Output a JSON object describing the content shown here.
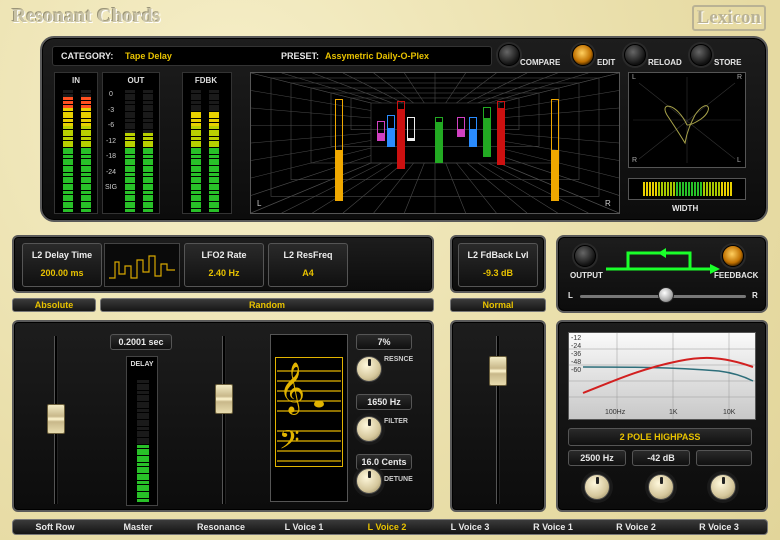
{
  "app": {
    "title": "Resonant Chords",
    "brand": "Lexicon"
  },
  "header": {
    "category_label": "CATEGORY:",
    "category_value": "Tape Delay",
    "preset_label": "PRESET:",
    "preset_value": "Assymetric Daily-O-Plex"
  },
  "buttons": {
    "compare": "COMPARE",
    "edit": "EDIT",
    "reload": "RELOAD",
    "store": "STORE"
  },
  "meters": {
    "in_label": "IN",
    "out_label": "OUT",
    "fdbk_label": "FDBK",
    "scale": [
      "0",
      "-3",
      "-6",
      "-12",
      "-18",
      "-24",
      "SIG"
    ],
    "in_level": 0.92,
    "out_level": 0.64,
    "fdbk_level": 0.82
  },
  "stage": {
    "left": "L",
    "right": "R"
  },
  "scope": {
    "l": "L",
    "r": "R",
    "width_label": "WIDTH"
  },
  "params": {
    "l2_delay_time": {
      "label": "L2 Delay Time",
      "value": "200.00 ms"
    },
    "lfo2_rate": {
      "label": "LFO2 Rate",
      "value": "2.40 Hz"
    },
    "l2_resfreq": {
      "label": "L2 ResFreq",
      "value": "A4"
    },
    "l2_fdback": {
      "label": "L2 FdBack Lvl",
      "value": "-9.3 dB"
    },
    "absolute": "Absolute",
    "random": "Random",
    "normal": "Normal"
  },
  "routing": {
    "output": "OUTPUT",
    "feedback": "FEEDBACK",
    "l": "L",
    "r": "R",
    "pan": 0.52
  },
  "delay": {
    "time": "0.2001 sec",
    "label": "DELAY",
    "level": 0.46
  },
  "voice": {
    "resonance_value": "7%",
    "resonance_label": "RESNCE",
    "filter_value": "1650 Hz",
    "filter_label": "FILTER",
    "detune_value": "16.0 Cents",
    "detune_label": "DETUNE"
  },
  "filter_eq": {
    "db_labels": [
      "-12",
      "-24",
      "-36",
      "-48",
      "-60"
    ],
    "freq_labels": [
      "100Hz",
      "1K",
      "10K"
    ],
    "type": "2 POLE HIGHPASS",
    "freq": "2500 Hz",
    "gain": "-42 dB",
    "extra": ""
  },
  "tabs": [
    "Soft Row",
    "Master",
    "Resonance",
    "L Voice 1",
    "L Voice 2",
    "L Voice 3",
    "R Voice 1",
    "R Voice 2",
    "R Voice 3"
  ],
  "selected_tab": "L Voice 2",
  "colors": {
    "accent": "#e8c200",
    "green": "#22ee22",
    "panel": "#121212"
  }
}
